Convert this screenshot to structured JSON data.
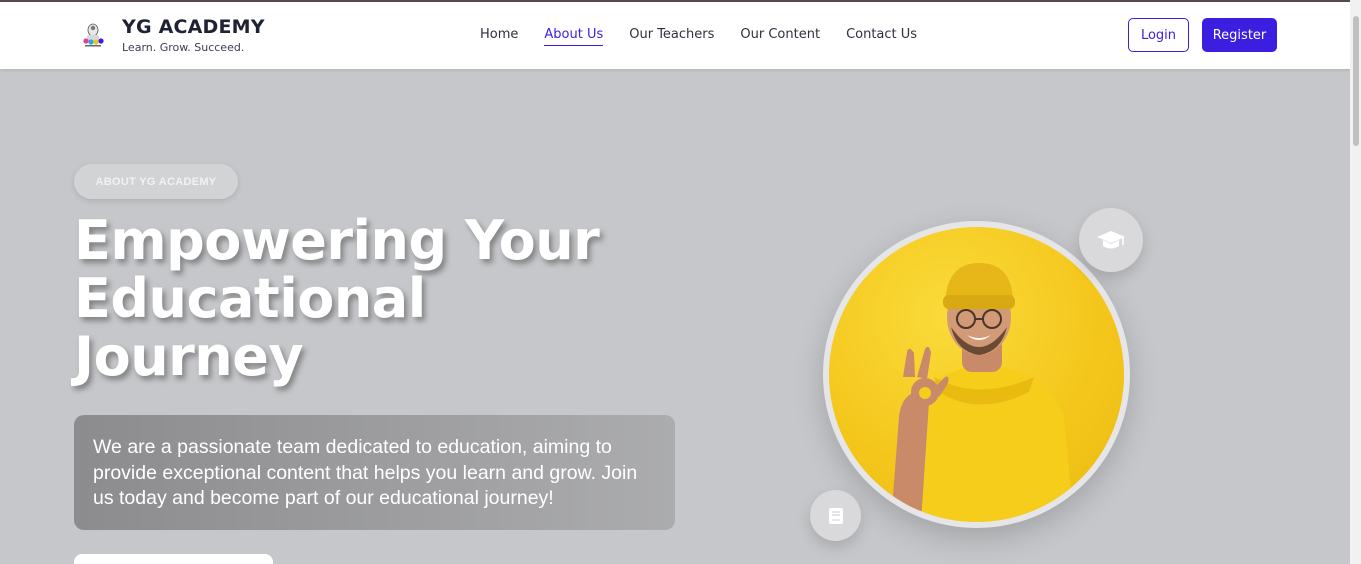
{
  "header": {
    "brand_name": "YG ACADEMY",
    "tagline": "Learn. Grow. Succeed.",
    "nav": [
      {
        "label": "Home",
        "active": false
      },
      {
        "label": "About Us",
        "active": true
      },
      {
        "label": "Our Teachers",
        "active": false
      },
      {
        "label": "Our Content",
        "active": false
      },
      {
        "label": "Contact Us",
        "active": false
      }
    ],
    "login_label": "Login",
    "register_label": "Register"
  },
  "hero": {
    "pill_label": "ABOUT YG ACADEMY",
    "title_lines": [
      "Empowering Your",
      "Educational",
      "Journey"
    ],
    "description": "We are a passionate team dedicated to education, aiming to provide exceptional content that helps you learn and grow. Join us today and become part of our educational journey!"
  },
  "icons": {
    "graduation": "graduation-cap-icon",
    "book": "book-icon",
    "logo": "academy-logo-icon"
  },
  "colors": {
    "accent": "#3b1ee0",
    "hero_background": "#c6c7ca",
    "photo_yellow": "#f4c51a"
  }
}
